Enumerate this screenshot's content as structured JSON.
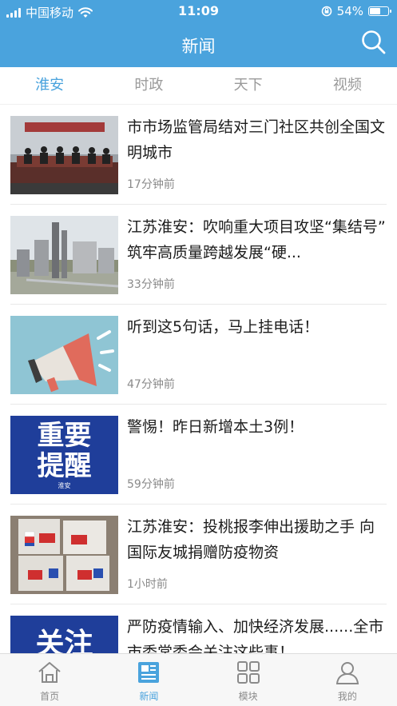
{
  "status_bar": {
    "carrier": "中国移动",
    "time": "11:09",
    "battery": "54%",
    "battery_level": 0.54
  },
  "nav": {
    "title": "新闻",
    "search_icon": "search-icon"
  },
  "tabs": [
    {
      "label": "淮安",
      "active": true
    },
    {
      "label": "时政",
      "active": false
    },
    {
      "label": "天下",
      "active": false
    },
    {
      "label": "视频",
      "active": false
    }
  ],
  "news": [
    {
      "title": "市市场监管局结对三门社区共创全国文明城市",
      "time": "17分钟前"
    },
    {
      "title": "江苏淮安：吹响重大项目攻坚“集结号” 筑牢高质量跨越发展“硬...",
      "time": "33分钟前"
    },
    {
      "title": "听到这5句话，马上挂电话！",
      "time": "47分钟前"
    },
    {
      "title": "警惕！昨日新增本土3例！",
      "time": "59分钟前"
    },
    {
      "title": "江苏淮安：投桃报李伸出援助之手 向国际友城捐赠防疫物资",
      "time": "1小时前"
    },
    {
      "title": "严防疫情输入、加快经济发展......全市市委常委会关注这些事！",
      "time": ""
    }
  ],
  "thumb_text": {
    "important_1": "重要",
    "important_2": "提醒",
    "important_source": "淮安",
    "attention": "关注"
  },
  "bottom_nav": [
    {
      "label": "首页",
      "icon": "home-icon",
      "active": false
    },
    {
      "label": "新闻",
      "icon": "news-icon",
      "active": true
    },
    {
      "label": "模块",
      "icon": "grid-icon",
      "active": false
    },
    {
      "label": "我的",
      "icon": "user-icon",
      "active": false
    }
  ],
  "colors": {
    "brand": "#4aa3dd",
    "text": "#1c1c1c",
    "muted": "#8a8a8a",
    "divider": "#e9e9e9",
    "bottom_bar_bg": "#f7f7f7"
  }
}
